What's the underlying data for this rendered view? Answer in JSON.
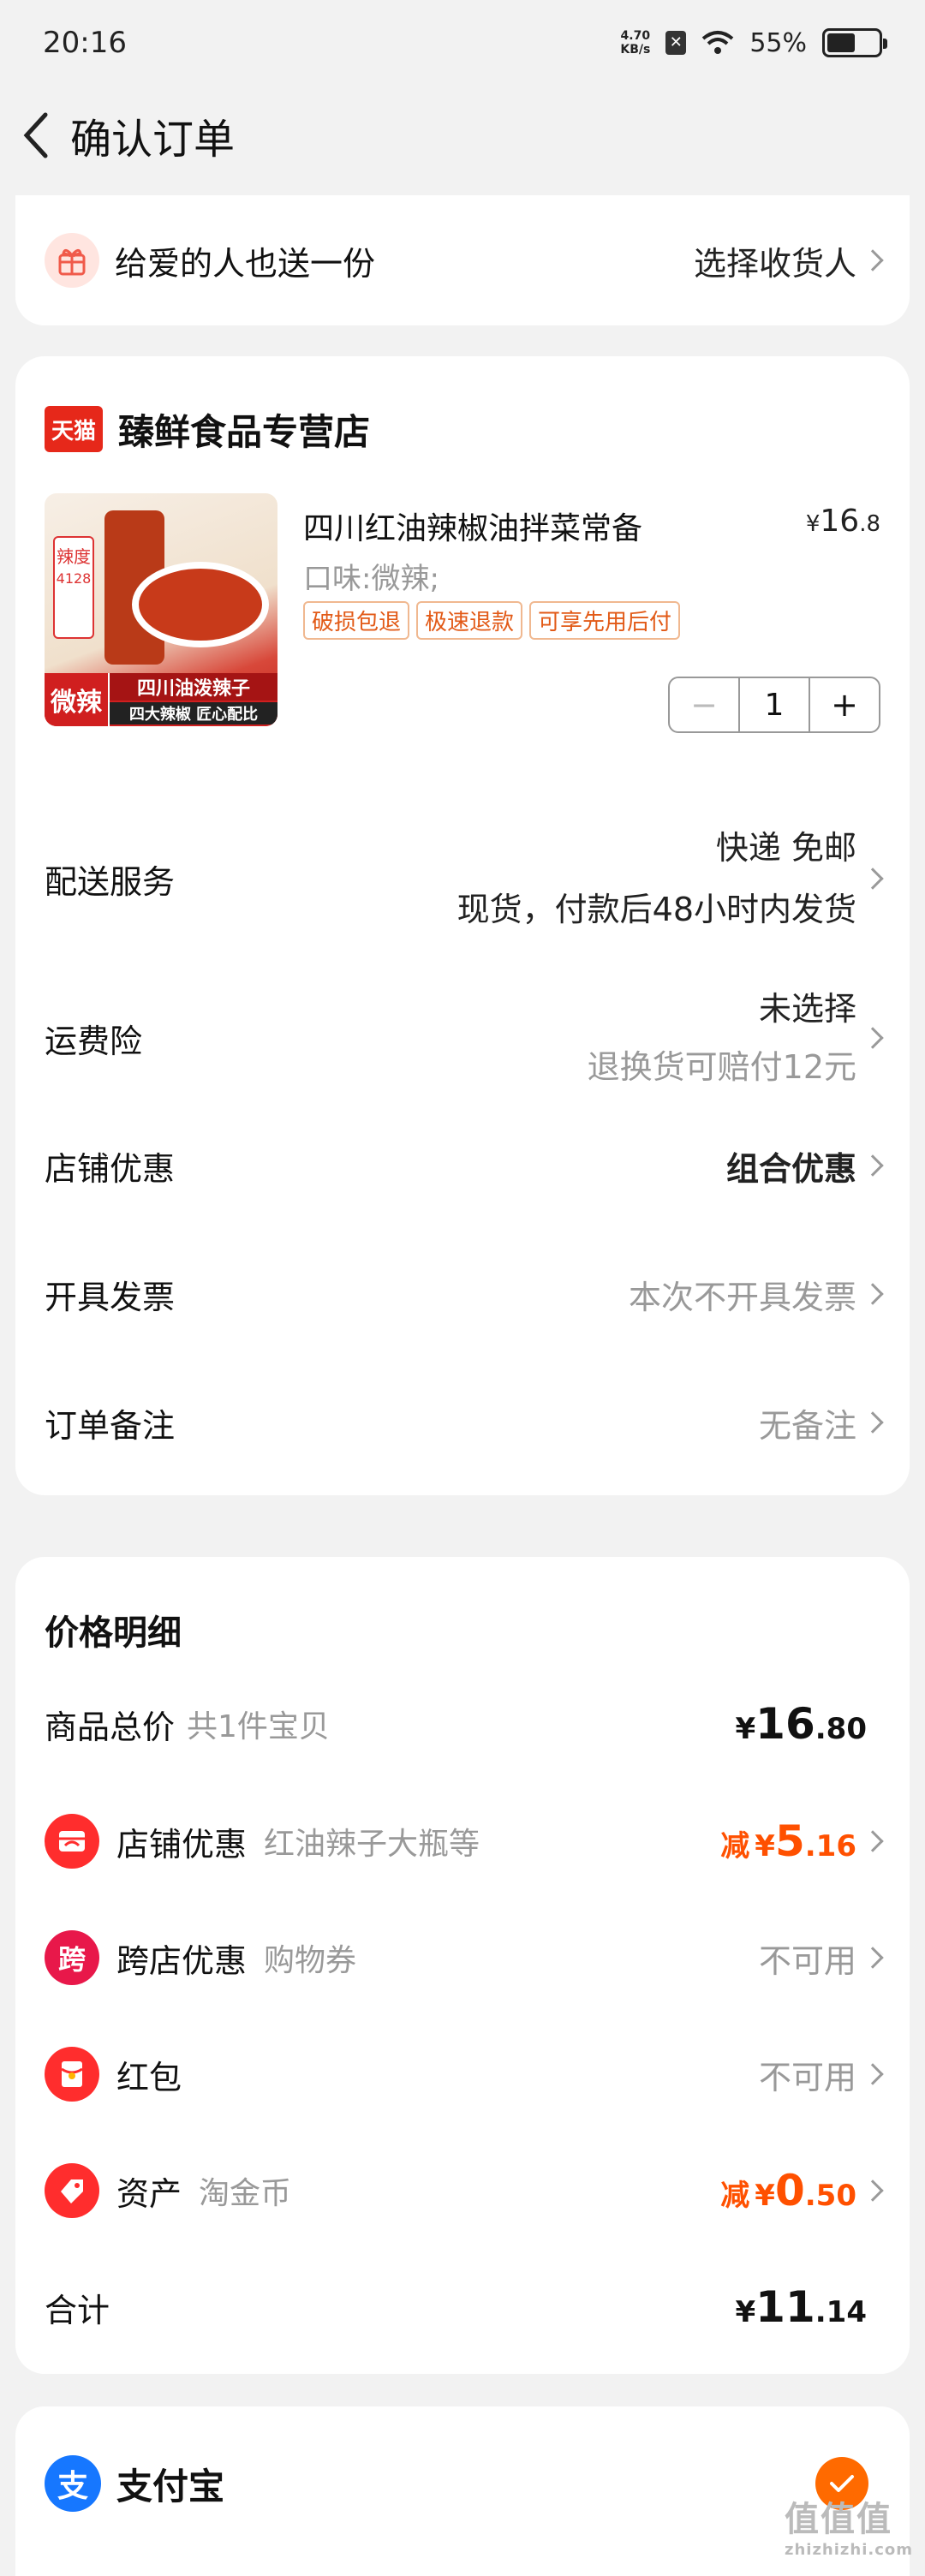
{
  "status": {
    "time": "20:16",
    "net_speed_value": "4.70",
    "net_speed_unit": "KB/s",
    "battery": "55%"
  },
  "nav": {
    "title": "确认订单"
  },
  "gift": {
    "label": "给爱的人也送一份",
    "action": "选择收货人"
  },
  "store": {
    "logo": "天猫",
    "name": "臻鲜食品专营店",
    "product": {
      "title": "四川红油辣椒油拌菜常备",
      "price_symbol": "¥",
      "price_int": "16",
      "price_dec": ".8",
      "spec": "口味:微辣;",
      "tags": [
        "破损包退",
        "极速退款",
        "可享先用后付"
      ],
      "quantity": "1",
      "image_text": {
        "top": "辣度",
        "code": "4128",
        "badge": "微辣",
        "line1": "四川油泼辣子",
        "line2": "四大辣椒 匠心配比"
      }
    },
    "delivery": {
      "label": "配送服务",
      "line1": "快递 免邮",
      "line2": "现货，付款后48小时内发货"
    },
    "insurance": {
      "label": "运费险",
      "line1": "未选择",
      "line2": "退换货可赔付12元"
    },
    "discount": {
      "label": "店铺优惠",
      "value": "组合优惠"
    },
    "invoice": {
      "label": "开具发票",
      "value": "本次不开具发票"
    },
    "note": {
      "label": "订单备注",
      "value": "无备注"
    }
  },
  "price_detail": {
    "title": "价格明细",
    "total": {
      "label": "商品总价",
      "sub": "共1件宝贝",
      "symbol": "¥",
      "int": "16",
      "dec": ".80"
    },
    "shop_discount": {
      "label": "店铺优惠",
      "sub": "红油辣子大瓶等",
      "prefix": "减",
      "symbol": "¥",
      "int": "5",
      "dec": ".16"
    },
    "cross_store": {
      "icon_text": "跨",
      "label": "跨店优惠",
      "sub": "购物券",
      "value": "不可用"
    },
    "redpacket": {
      "label": "红包",
      "value": "不可用"
    },
    "assets": {
      "label": "资产",
      "sub": "淘金币",
      "prefix": "减",
      "symbol": "¥",
      "int": "0",
      "dec": ".50"
    },
    "sum": {
      "label": "合计",
      "symbol": "¥",
      "int": "11",
      "dec": ".14"
    }
  },
  "payment": {
    "icon_text": "支",
    "label": "支付宝"
  },
  "watermark": {
    "main": "值值值",
    "sub": "zhizhizhi.com"
  },
  "colors": {
    "accent": "#ff5000",
    "tmall_red": "#e6281a",
    "alipay_blue": "#1677ff",
    "icon_red": "#ff2d2d"
  }
}
